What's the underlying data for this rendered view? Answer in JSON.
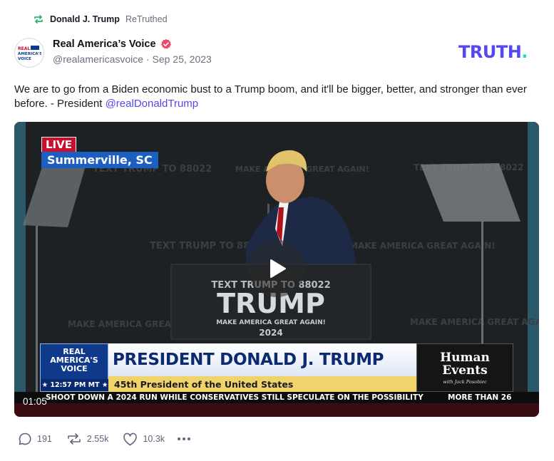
{
  "retruth": {
    "user": "Donald J. Trump",
    "label": "ReTruthed",
    "icon": "retruth-icon"
  },
  "author": {
    "avatar_text": "REAL AMERICA'S VOICE",
    "name": "Real America’s Voice",
    "verified_icon": "verified-badge-icon",
    "handle": "@realamericasvoice",
    "separator": "·",
    "date": "Sep 25, 2023"
  },
  "brand": {
    "logo_text": "TRUTH",
    "logo_dot": ".",
    "colors": {
      "primary": "#5448ee",
      "accent": "#17e0c4"
    }
  },
  "post": {
    "text": "We are to go from a Biden economic bust to a Trump boom, and it'll be bigger, better, and stronger than ever before.  - President ",
    "mention": "@realDonaldTrump"
  },
  "video": {
    "live_badge": "LIVE",
    "location": "Summerville, SC",
    "play_icon": "play-icon",
    "timestamp": "01:05",
    "lower_third": {
      "network_logo": "REAL AMERICA'S VOICE",
      "time": "★ 12:57 PM MT ★",
      "headline": "PRESIDENT DONALD J. TRUMP",
      "subtitle": "45th President of the United States",
      "sponsor_title": "Human Events",
      "sponsor_sub": "with Jack Posobiec"
    },
    "ticker": {
      "text": "SHOOT DOWN A 2024 RUN WHILE CONSERVATIVES STILL SPECULATE ON THE POSSIBILITY",
      "text2": "MORE THAN 26"
    },
    "podium": {
      "line1": "TEXT TRUMP TO 88022",
      "line2": "TRUMP",
      "line3": "MAKE AMERICA GREAT AGAIN!",
      "line4": "2024"
    },
    "backdrop": {
      "text_a": "TEXT TRUMP TO 88022",
      "text_b": "MAKE AMERICA GREAT AGAIN!"
    }
  },
  "actions": {
    "replies": {
      "icon": "reply-icon",
      "count": "191"
    },
    "retruths": {
      "icon": "retruth-icon",
      "count": "2.55k"
    },
    "likes": {
      "icon": "heart-icon",
      "count": "10.3k"
    },
    "more_icon": "more-options-icon"
  }
}
